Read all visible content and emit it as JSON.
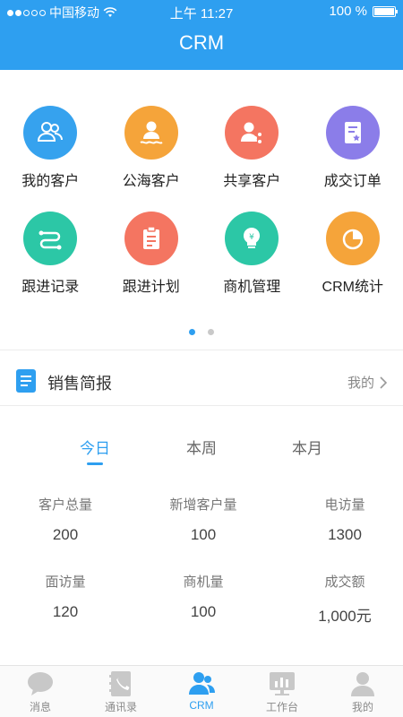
{
  "status_bar": {
    "carrier": "中国移动",
    "time": "上午 11:27",
    "battery": "100 %"
  },
  "header": {
    "title": "CRM"
  },
  "menu": {
    "items": [
      {
        "label": "我的客户",
        "icon": "customers-icon",
        "color": "#36a2ee"
      },
      {
        "label": "公海客户",
        "icon": "public-customer-icon",
        "color": "#f5a43a"
      },
      {
        "label": "共享客户",
        "icon": "shared-customer-icon",
        "color": "#f47561"
      },
      {
        "label": "成交订单",
        "icon": "order-icon",
        "color": "#8b7de9"
      },
      {
        "label": "跟进记录",
        "icon": "followup-record-icon",
        "color": "#2cc7a6"
      },
      {
        "label": "跟进计划",
        "icon": "followup-plan-icon",
        "color": "#f47561"
      },
      {
        "label": "商机管理",
        "icon": "opportunity-icon",
        "color": "#2cc7a6"
      },
      {
        "label": "CRM统计",
        "icon": "pie-chart-icon",
        "color": "#f5a43a"
      }
    ],
    "pages": 2,
    "current_page": 1
  },
  "brief": {
    "title": "销售简报",
    "scope": "我的"
  },
  "period_tabs": {
    "items": [
      "今日",
      "本周",
      "本月"
    ],
    "active": 0
  },
  "stats": [
    {
      "label": "客户总量",
      "value": "200"
    },
    {
      "label": "新增客户量",
      "value": "100"
    },
    {
      "label": "电访量",
      "value": "1300"
    },
    {
      "label": "面访量",
      "value": "120"
    },
    {
      "label": "商机量",
      "value": "100"
    },
    {
      "label": "成交额",
      "value": "1,000元"
    }
  ],
  "tabbar": {
    "items": [
      {
        "label": "消息",
        "icon": "message-icon"
      },
      {
        "label": "通讯录",
        "icon": "contacts-icon"
      },
      {
        "label": "CRM",
        "icon": "crm-icon"
      },
      {
        "label": "工作台",
        "icon": "workbench-icon"
      },
      {
        "label": "我的",
        "icon": "profile-icon"
      }
    ],
    "active": 2,
    "active_color": "#2e9ff0",
    "inactive_color": "#c8c8c8"
  }
}
